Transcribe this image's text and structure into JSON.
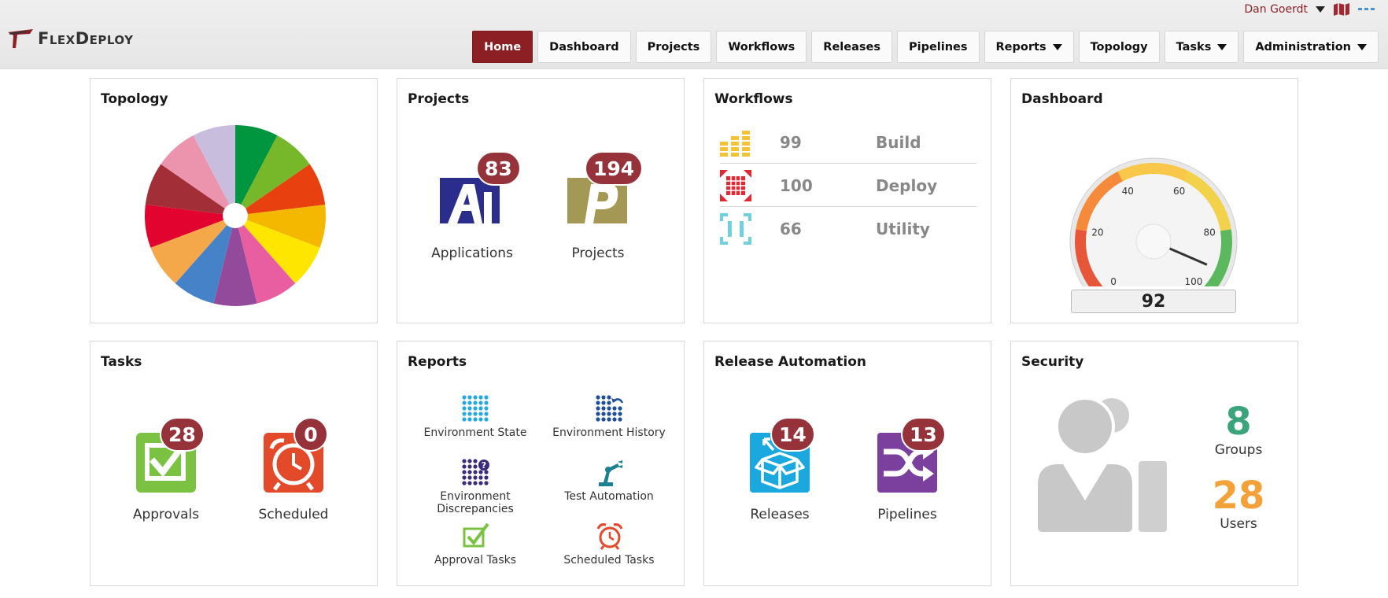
{
  "header": {
    "logo_text": "FlexDeploy",
    "user_name": "Dan Goerdt",
    "nav": [
      {
        "label": "Home",
        "active": true,
        "has_menu": false
      },
      {
        "label": "Dashboard",
        "active": false,
        "has_menu": false
      },
      {
        "label": "Projects",
        "active": false,
        "has_menu": false
      },
      {
        "label": "Workflows",
        "active": false,
        "has_menu": false
      },
      {
        "label": "Releases",
        "active": false,
        "has_menu": false
      },
      {
        "label": "Pipelines",
        "active": false,
        "has_menu": false
      },
      {
        "label": "Reports",
        "active": false,
        "has_menu": true
      },
      {
        "label": "Topology",
        "active": false,
        "has_menu": false
      },
      {
        "label": "Tasks",
        "active": false,
        "has_menu": true
      },
      {
        "label": "Administration",
        "active": false,
        "has_menu": true
      }
    ]
  },
  "topology": {
    "title": "Topology",
    "slice_colors": [
      "#00963f",
      "#76b82a",
      "#e8410f",
      "#f5b800",
      "#ffe600",
      "#e95ea0",
      "#934a9a",
      "#4682c8",
      "#f4a84a",
      "#e2032e",
      "#a22e38",
      "#ec94ae",
      "#c8bddc"
    ]
  },
  "projects": {
    "title": "Projects",
    "applications_count": "83",
    "applications_label": "Applications",
    "projects_count": "194",
    "projects_label": "Projects"
  },
  "workflows": {
    "title": "Workflows",
    "rows": [
      {
        "count": "99",
        "label": "Build",
        "icon": "build-icon",
        "color": "#f6c232"
      },
      {
        "count": "100",
        "label": "Deploy",
        "icon": "deploy-icon",
        "color": "#e02a33"
      },
      {
        "count": "66",
        "label": "Utility",
        "icon": "utility-icon",
        "color": "#6fd0e0"
      }
    ]
  },
  "dashboard": {
    "title": "Dashboard",
    "gauge_min": 0,
    "gauge_max": 100,
    "gauge_ticks": [
      "0",
      "20",
      "40",
      "60",
      "80",
      "100"
    ],
    "value": 92,
    "value_label": "92"
  },
  "tasks": {
    "title": "Tasks",
    "approvals_count": "28",
    "approvals_label": "Approvals",
    "scheduled_count": "0",
    "scheduled_label": "Scheduled"
  },
  "reports": {
    "title": "Reports",
    "items": [
      {
        "label": "Environment State",
        "icon": "grid-icon",
        "color": "#29a8e0"
      },
      {
        "label": "Environment History",
        "icon": "history-icon",
        "color": "#1f4e9a"
      },
      {
        "label": "Environment Discrepancies",
        "icon": "question-grid-icon",
        "color": "#3c2a7a"
      },
      {
        "label": "Test Automation",
        "icon": "robot-arm-icon",
        "color": "#1b8090"
      },
      {
        "label": "Approval Tasks",
        "icon": "checkbox-icon",
        "color": "#7cc242"
      },
      {
        "label": "Scheduled Tasks",
        "icon": "alarm-clock-icon",
        "color": "#e24a2a"
      }
    ]
  },
  "release_automation": {
    "title": "Release Automation",
    "releases_count": "14",
    "releases_label": "Releases",
    "pipelines_count": "13",
    "pipelines_label": "Pipelines"
  },
  "security": {
    "title": "Security",
    "groups_count": "8",
    "groups_label": "Groups",
    "users_count": "28",
    "users_label": "Users",
    "groups_color": "#3aa57a",
    "users_color": "#f3a23a"
  }
}
